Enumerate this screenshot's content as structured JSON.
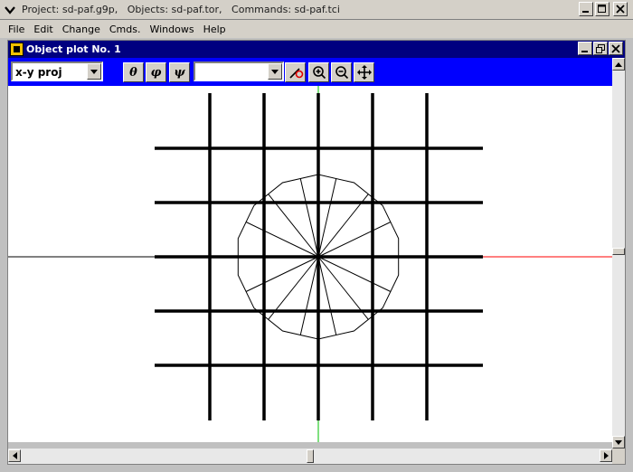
{
  "app": {
    "title": "Project: sd-paf.g9p,   Objects: sd-paf.tor,   Commands: sd-paf.tci"
  },
  "menu": {
    "items": [
      "File",
      "Edit",
      "Change",
      "Cmds.",
      "Windows",
      "Help"
    ]
  },
  "child": {
    "title": "Object plot No. 1"
  },
  "toolbar": {
    "projection_value": "x-y proj",
    "theta_label": "θ",
    "phi_label": "φ",
    "psi_label": "ψ",
    "second_combo_value": ""
  },
  "plot": {
    "colors": {
      "background": "#ffffff",
      "grid": "#000000",
      "x_axis_positive": "#ff0000",
      "y_axis_positive": "#00c000",
      "axis_negative": "#000000",
      "object": "#000000"
    }
  },
  "icons": {
    "system_menu": "chevron-down-icon",
    "minimize": "minimize-icon",
    "maximize": "maximize-icon",
    "restore": "restore-icon",
    "close": "close-icon",
    "rotate_tool": "rotate-view-icon",
    "zoom_in": "zoom-in-icon",
    "zoom_out": "zoom-out-icon",
    "pan": "pan-icon"
  }
}
